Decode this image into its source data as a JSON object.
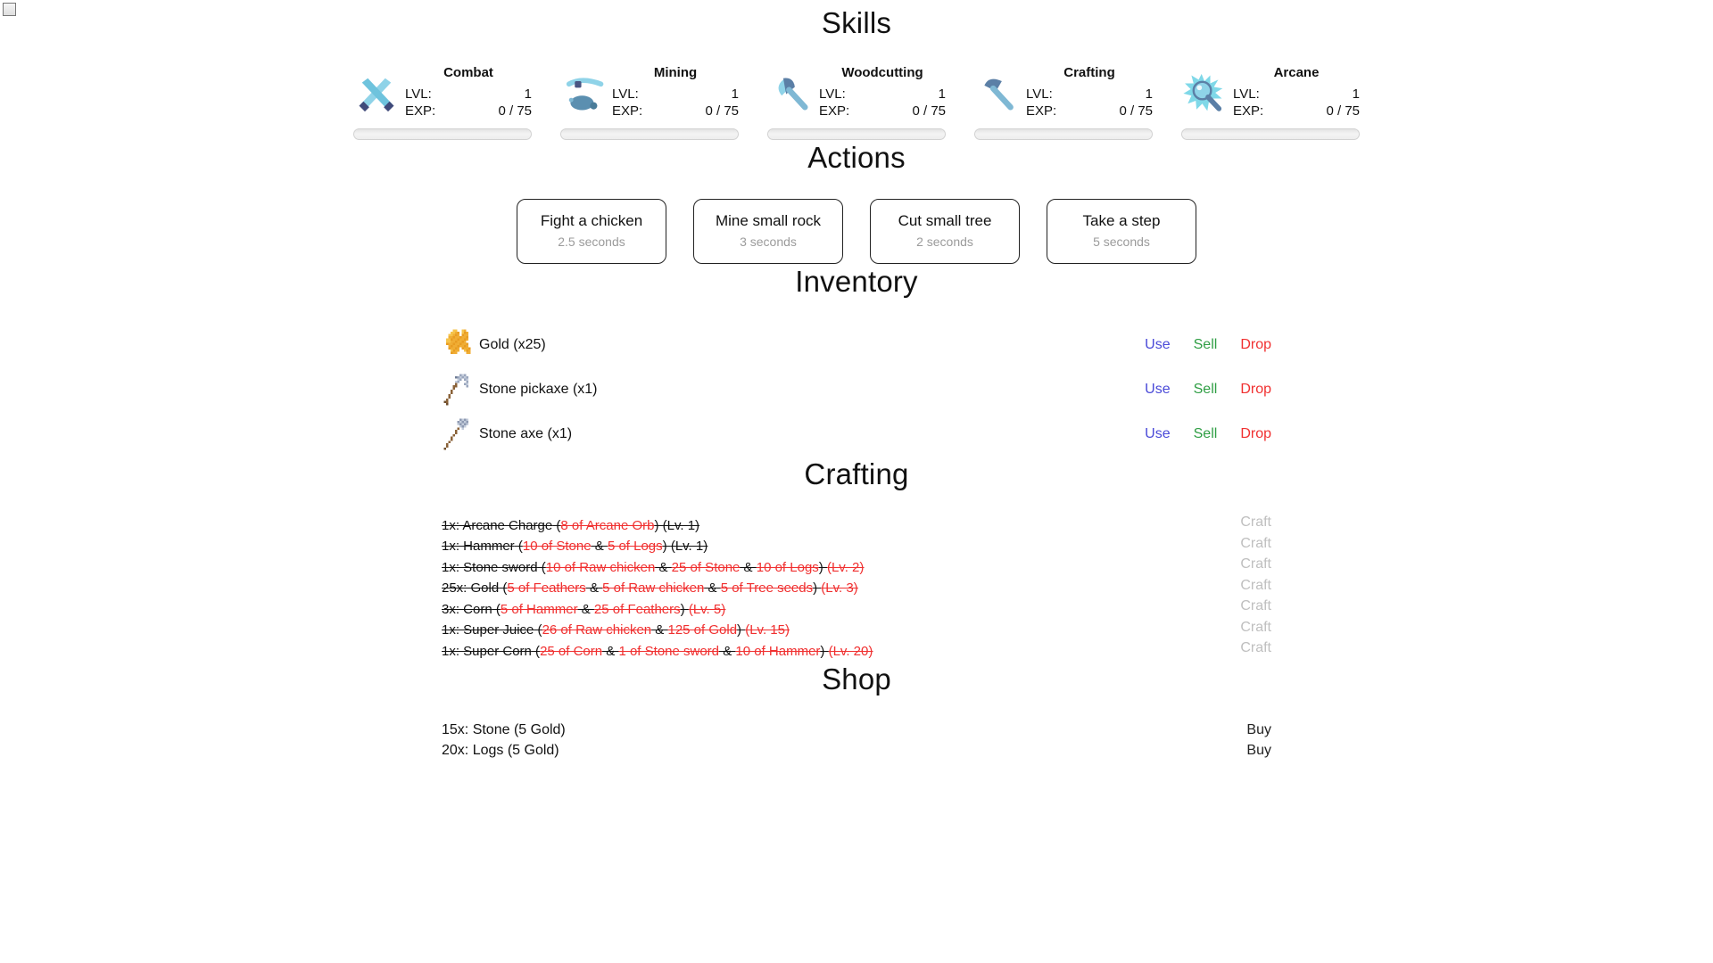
{
  "skills": {
    "title": "Skills",
    "lvl_label": "LVL:",
    "exp_label": "EXP:",
    "items": [
      {
        "name": "Combat",
        "icon": "crossed-swords-icon",
        "level": "1",
        "exp": "0 / 75",
        "exp_percent": 0
      },
      {
        "name": "Mining",
        "icon": "pickaxe-icon",
        "level": "1",
        "exp": "0 / 75",
        "exp_percent": 0
      },
      {
        "name": "Woodcutting",
        "icon": "axe-icon",
        "level": "1",
        "exp": "0 / 75",
        "exp_percent": 0
      },
      {
        "name": "Crafting",
        "icon": "hammer-icon",
        "level": "1",
        "exp": "0 / 75",
        "exp_percent": 0
      },
      {
        "name": "Arcane",
        "icon": "magic-orb-icon",
        "level": "1",
        "exp": "0 / 75",
        "exp_percent": 0
      }
    ]
  },
  "actions": {
    "title": "Actions",
    "items": [
      {
        "label": "Fight a chicken",
        "duration": "2.5 seconds"
      },
      {
        "label": "Mine small rock",
        "duration": "3 seconds"
      },
      {
        "label": "Cut small tree",
        "duration": "2 seconds"
      },
      {
        "label": "Take a step",
        "duration": "5 seconds"
      }
    ]
  },
  "inventory": {
    "title": "Inventory",
    "use_label": "Use",
    "sell_label": "Sell",
    "drop_label": "Drop",
    "items": [
      {
        "name": "Gold (x25)",
        "icon": "gold-coins-icon"
      },
      {
        "name": "Stone pickaxe (x1)",
        "icon": "stone-pickaxe-icon"
      },
      {
        "name": "Stone axe (x1)",
        "icon": "stone-axe-icon"
      }
    ]
  },
  "crafting": {
    "title": "Crafting",
    "craft_label": "Craft",
    "recipes": [
      {
        "output": "1x: Arcane Charge",
        "requirements": [
          "8 of Arcane Orb"
        ],
        "level_req": "(Lv. 1)",
        "level_met": true,
        "craftable": false
      },
      {
        "output": "1x: Hammer",
        "requirements": [
          "10 of Stone",
          "5 of Logs"
        ],
        "level_req": "(Lv. 1)",
        "level_met": true,
        "craftable": false
      },
      {
        "output": "1x: Stone sword",
        "requirements": [
          "10 of Raw chicken",
          "25 of Stone",
          "10 of Logs"
        ],
        "level_req": "(Lv. 2)",
        "level_met": false,
        "craftable": false
      },
      {
        "output": "25x: Gold",
        "requirements": [
          "5 of Feathers",
          "5 of Raw chicken",
          "5 of Tree seeds"
        ],
        "level_req": "(Lv. 3)",
        "level_met": false,
        "craftable": false
      },
      {
        "output": "3x: Corn",
        "requirements": [
          "5 of Hammer",
          "25 of Feathers"
        ],
        "level_req": "(Lv. 5)",
        "level_met": false,
        "craftable": false
      },
      {
        "output": "1x: Super Juice",
        "requirements": [
          "26 of Raw chicken",
          "125 of Gold"
        ],
        "level_req": "(Lv. 15)",
        "level_met": false,
        "craftable": false
      },
      {
        "output": "1x: Super Corn",
        "requirements": [
          "25 of Corn",
          "1 of Stone sword",
          "10 of Hammer"
        ],
        "level_req": "(Lv. 20)",
        "level_met": false,
        "craftable": false
      }
    ]
  },
  "shop": {
    "title": "Shop",
    "buy_label": "Buy",
    "items": [
      {
        "name": "15x: Stone (5 Gold)"
      },
      {
        "name": "20x: Logs (5 Gold)"
      }
    ]
  },
  "colors": {
    "use": "#4a4ad8",
    "sell": "#2f9e44",
    "drop": "#f03030",
    "requirement_unmet": "#f03030",
    "disabled": "#bfbfbf",
    "text": "#111111",
    "muted": "#9b9b9b"
  }
}
